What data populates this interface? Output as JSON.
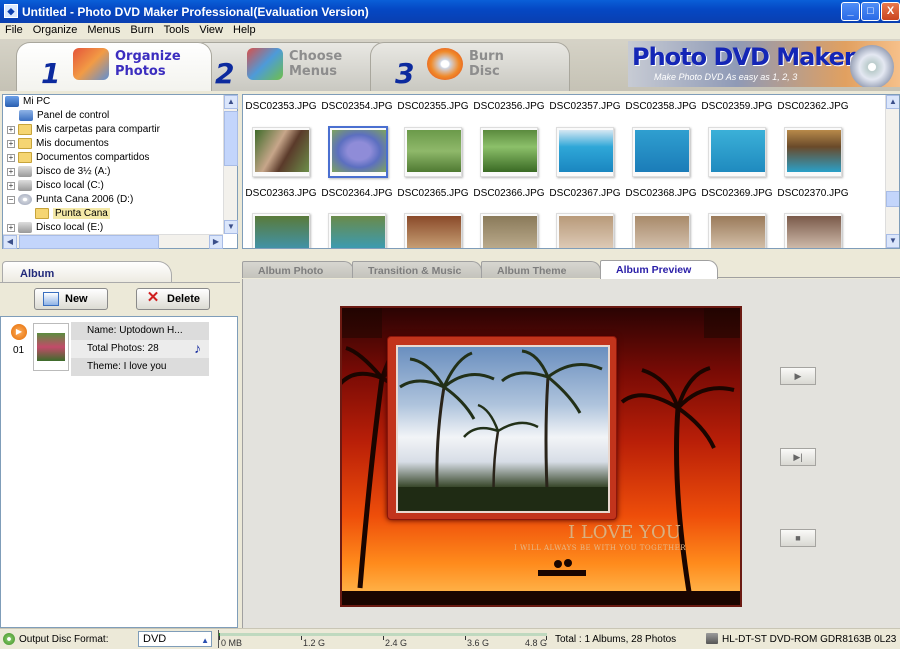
{
  "window": {
    "title": "Untitled - Photo DVD Maker Professional(Evaluation Version)",
    "minimize": "_",
    "maximize": "□",
    "close": "X"
  },
  "menu": [
    "File",
    "Organize",
    "Menus",
    "Burn",
    "Tools",
    "View",
    "Help"
  ],
  "steps": [
    {
      "num": "1",
      "line1": "Organize",
      "line2": "Photos"
    },
    {
      "num": "2",
      "line1": "Choose",
      "line2": "Menus"
    },
    {
      "num": "3",
      "line1": "Burn",
      "line2": "Disc"
    }
  ],
  "brand": {
    "title": "Photo DVD Maker",
    "slogan": "Make Photo DVD As easy as 1, 2, 3"
  },
  "tree": [
    {
      "label": "Mi PC",
      "icon": "computer-icon"
    },
    {
      "label": "Panel de control",
      "icon": "control-panel-icon"
    },
    {
      "label": "Mis carpetas para compartir",
      "icon": "folder-icon"
    },
    {
      "label": "Mis documentos",
      "icon": "folder-icon"
    },
    {
      "label": "Documentos compartidos",
      "icon": "folder-icon"
    },
    {
      "label": "Disco de 3½ (A:)",
      "icon": "floppy-drive-icon"
    },
    {
      "label": "Disco local (C:)",
      "icon": "hard-drive-icon"
    },
    {
      "label": "Punta Cana 2006 (D:)",
      "icon": "cd-drive-icon"
    },
    {
      "label": "Punta Cana",
      "icon": "open-folder-icon"
    },
    {
      "label": "Disco local (E:)",
      "icon": "hard-drive-icon"
    }
  ],
  "gallery": {
    "row1_labels": [
      "DSC02353.JPG",
      "DSC02354.JPG",
      "DSC02355.JPG",
      "DSC02356.JPG",
      "DSC02357.JPG",
      "DSC02358.JPG",
      "DSC02359.JPG",
      "DSC02362.JPG"
    ],
    "row2_labels": [
      "DSC02363.JPG",
      "DSC02364.JPG",
      "DSC02365.JPG",
      "DSC02366.JPG",
      "DSC02367.JPG",
      "DSC02368.JPG",
      "DSC02369.JPG",
      "DSC02370.JPG"
    ]
  },
  "album": {
    "tab": "Album",
    "new": "New",
    "delete": "Delete",
    "index": "01",
    "name": "Name: Uptodown H...",
    "photos": "Total Photos: 28",
    "theme": "Theme: I love you",
    "music_glyph": "♪"
  },
  "tabs": [
    "Album Photo",
    "Transition & Music",
    "Album Theme",
    "Album Preview"
  ],
  "preview": {
    "title": "I LOVE YOU",
    "subtitle": "I WILL ALWAYS BE WITH YOU TOGETHER",
    "controls": [
      "▶",
      "▶|",
      "■"
    ]
  },
  "status": {
    "format_label": "Output Disc Format:",
    "format_value": "DVD",
    "ruler": [
      "0 MB",
      "1.2 G",
      "2.4 G",
      "3.6 G",
      "4.8 G"
    ],
    "total": "Total : 1 Albums, 28 Photos",
    "drive": "HL-DT-ST DVD-ROM GDR8163B 0L23"
  },
  "colors": {
    "title_bar": "#0a4fd0",
    "brand_text": "#1426b6",
    "active_tab_text": "#2a1ea8",
    "preview_bg": "#ee4e0a"
  }
}
